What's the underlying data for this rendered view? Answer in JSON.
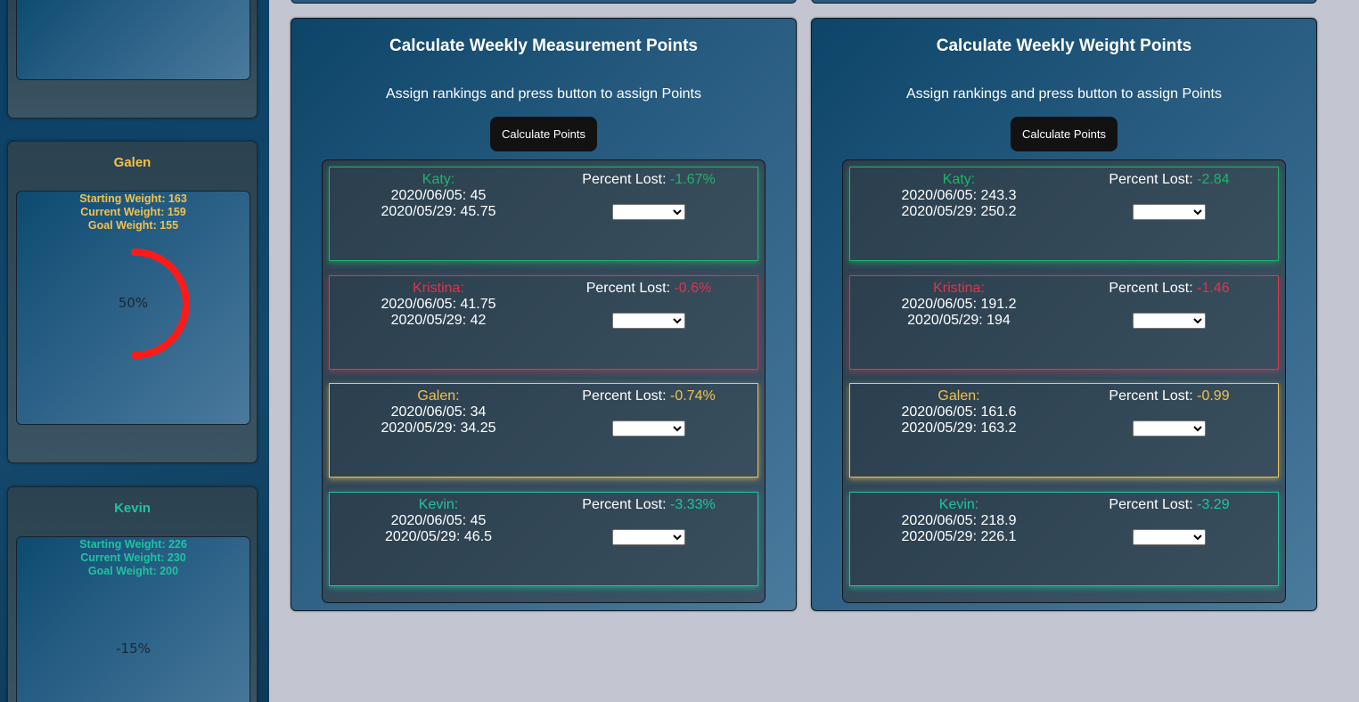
{
  "sidebar": {
    "players": [
      {
        "name": "",
        "color": "#f2c14e"
      },
      {
        "name": "Galen",
        "color": "#f2c14e",
        "starting": "Starting Weight: 163",
        "current": "Current Weight: 159",
        "goal": "Goal Weight: 155",
        "progress_label": "50%",
        "progress": 0.5,
        "ring_color": "#ff1a1a"
      },
      {
        "name": "Kevin",
        "color": "#1ec4a0",
        "starting": "Starting Weight: 226",
        "current": "Current Weight: 230",
        "goal": "Goal Weight: 200",
        "progress_label": "-15%",
        "progress": -0.15
      }
    ]
  },
  "panels": [
    {
      "title": "Calculate Weekly Measurement Points",
      "subtitle": "Assign rankings and press button to assign Points",
      "button": "Calculate Points",
      "entries": [
        {
          "name": "Katy:",
          "color": "#1fb46a",
          "date1": "2020/06/05: 45",
          "date2": "2020/05/29: 45.75",
          "pct_label": "Percent Lost: ",
          "pct": "-1.67%"
        },
        {
          "name": "Kristina:",
          "color": "#e0344a",
          "date1": "2020/06/05: 41.75",
          "date2": "2020/05/29: 42",
          "pct_label": "Percent Lost: ",
          "pct": "-0.6%"
        },
        {
          "name": "Galen:",
          "color": "#f2c14e",
          "date1": "2020/06/05: 34",
          "date2": "2020/05/29: 34.25",
          "pct_label": "Percent Lost: ",
          "pct": "-0.74%"
        },
        {
          "name": "Kevin:",
          "color": "#1ec4a0",
          "date1": "2020/06/05: 45",
          "date2": "2020/05/29: 46.5",
          "pct_label": "Percent Lost: ",
          "pct": "-3.33%"
        }
      ]
    },
    {
      "title": "Calculate Weekly Weight Points",
      "subtitle": "Assign rankings and press button to assign Points",
      "button": "Calculate Points",
      "entries": [
        {
          "name": "Katy:",
          "color": "#1fb46a",
          "date1": "2020/06/05: 243.3",
          "date2": "2020/05/29: 250.2",
          "pct_label": "Percent Lost: ",
          "pct": "-2.84"
        },
        {
          "name": "Kristina:",
          "color": "#e0344a",
          "date1": "2020/06/05: 191.2",
          "date2": "2020/05/29: 194",
          "pct_label": "Percent Lost: ",
          "pct": "-1.46"
        },
        {
          "name": "Galen:",
          "color": "#f2c14e",
          "date1": "2020/06/05: 161.6",
          "date2": "2020/05/29: 163.2",
          "pct_label": "Percent Lost: ",
          "pct": "-0.99"
        },
        {
          "name": "Kevin:",
          "color": "#1ec4a0",
          "date1": "2020/06/05: 218.9",
          "date2": "2020/05/29: 226.1",
          "pct_label": "Percent Lost: ",
          "pct": "-3.29"
        }
      ]
    }
  ]
}
